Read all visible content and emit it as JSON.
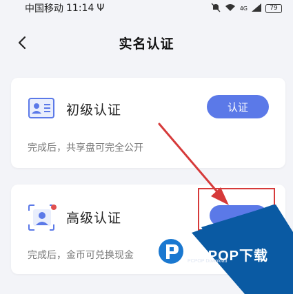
{
  "status_bar": {
    "carrier": "中国移动",
    "time": "11:14",
    "usb": "Ψ",
    "signal": "4G",
    "battery": "79"
  },
  "header": {
    "title": "实名认证"
  },
  "cards": [
    {
      "title": "初级认证",
      "description": "完成后，共享盘可完全公开",
      "button_label": "认证"
    },
    {
      "title": "高级认证",
      "description": "完成后，金币可兑换现金"
    }
  ],
  "watermark": {
    "brand": "PCPOP下载",
    "sub": "PCPOP Download"
  },
  "colors": {
    "accent": "#5b79e8",
    "highlight": "#d63a3a",
    "watermark_blue": "#0a5aa3"
  }
}
